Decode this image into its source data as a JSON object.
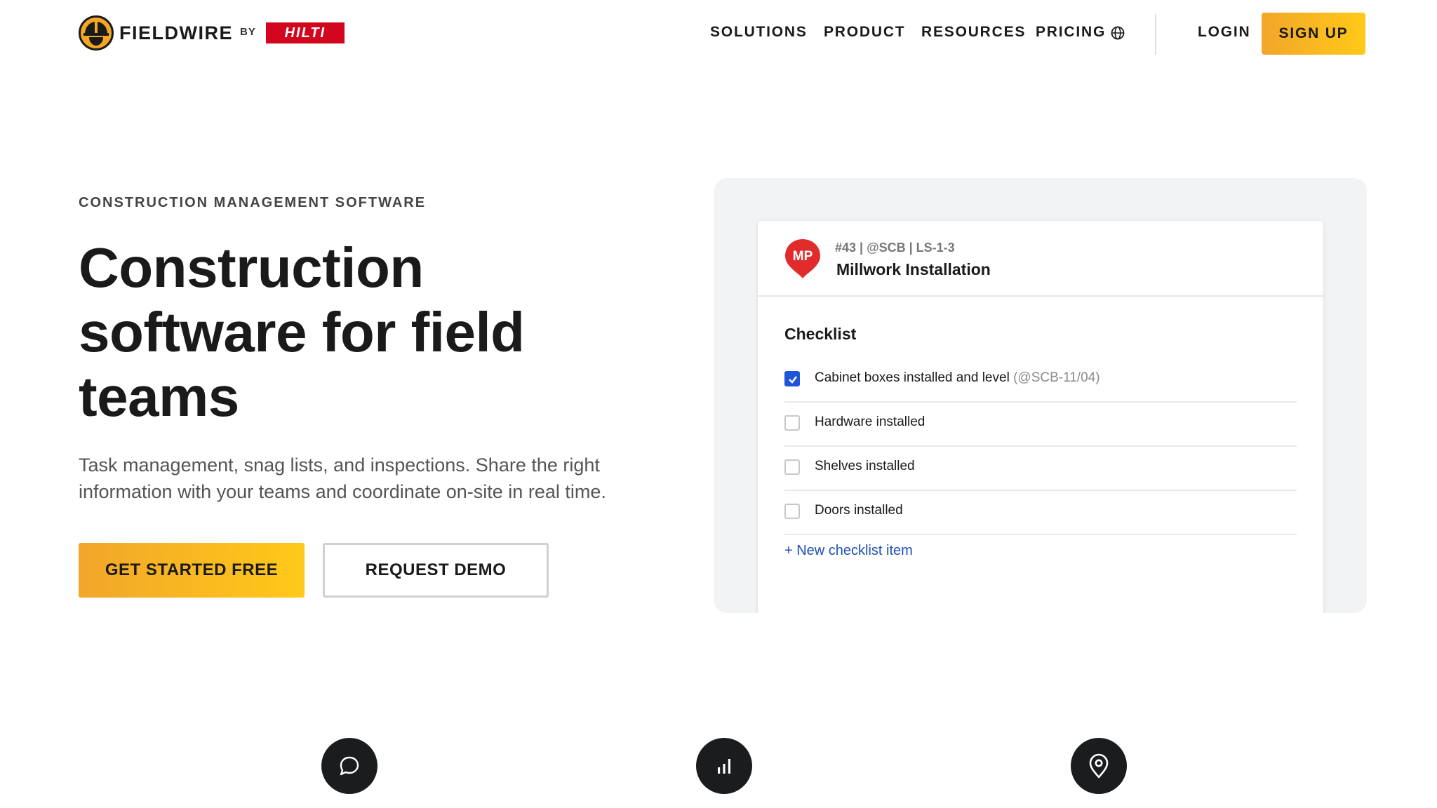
{
  "header": {
    "logo": {
      "brand": "FIELDWIRE",
      "by": "BY",
      "parent": "HILTI"
    },
    "nav": [
      "SOLUTIONS",
      "PRODUCT",
      "RESOURCES",
      "PRICING"
    ],
    "globe_icon": "globe-icon",
    "login": "LOGIN",
    "signup": "SIGN UP",
    "accent_color": "#f7b423"
  },
  "hero": {
    "eyebrow": "CONSTRUCTION MANAGEMENT SOFTWARE",
    "headline": "Construction software for field teams",
    "subtext": "Task management, snag lists, and inspections. Share the right information with your teams and coordinate on-site in real time.",
    "primary_cta": "GET STARTED FREE",
    "secondary_cta": "REQUEST DEMO"
  },
  "preview": {
    "pin_label": "MP",
    "pin_color": "#e22b2b",
    "meta": "#43 | @SCB | LS-1-3",
    "title": "Millwork Installation",
    "checklist_title": "Checklist",
    "items": [
      {
        "label": "Cabinet boxes installed and level",
        "ref": "(@SCB-11/04)",
        "checked": true
      },
      {
        "label": "Hardware installed",
        "ref": "",
        "checked": false
      },
      {
        "label": "Shelves installed",
        "ref": "",
        "checked": false
      },
      {
        "label": "Doors installed",
        "ref": "",
        "checked": false
      }
    ],
    "new_item": "+ New checklist item",
    "check_color": "#1f56d8"
  },
  "features": {
    "icons": [
      "chat-bubble-icon",
      "bar-chart-icon",
      "location-pin-icon"
    ]
  }
}
